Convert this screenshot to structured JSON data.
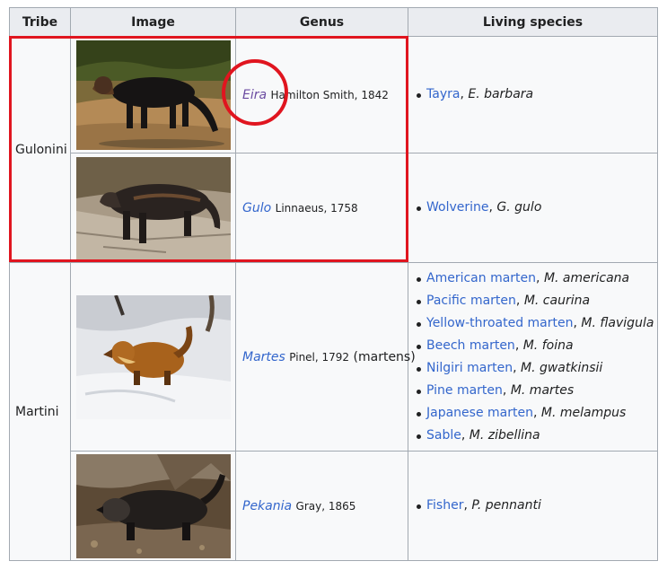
{
  "headers": [
    "Tribe",
    "Image",
    "Genus",
    "Living species"
  ],
  "tribes": {
    "gulonini": "Gulonini",
    "martini": "Martini"
  },
  "rows": {
    "eira": {
      "genus": "Eira",
      "authority": "Hamilton Smith, 1842",
      "species": [
        {
          "common": "Tayra",
          "sci": "E. barbara"
        }
      ]
    },
    "gulo": {
      "genus": "Gulo",
      "authority": "Linnaeus, 1758",
      "species": [
        {
          "common": "Wolverine",
          "sci": "G. gulo"
        }
      ]
    },
    "martes": {
      "genus": "Martes",
      "authority": "Pinel, 1792",
      "note": "(martens)",
      "species": [
        {
          "common": "American marten",
          "sci": "M. americana"
        },
        {
          "common": "Pacific marten",
          "sci": "M. caurina"
        },
        {
          "common": "Yellow-throated marten",
          "sci": "M. flavigula"
        },
        {
          "common": "Beech marten",
          "sci": "M. foina"
        },
        {
          "common": "Nilgiri marten",
          "sci": "M. gwatkinsii"
        },
        {
          "common": "Pine marten",
          "sci": "M. martes"
        },
        {
          "common": "Japanese marten",
          "sci": "M. melampus"
        },
        {
          "common": "Sable",
          "sci": "M. zibellina"
        }
      ]
    },
    "pekania": {
      "genus": "Pekania",
      "authority": "Gray, 1865",
      "species": [
        {
          "common": "Fisher",
          "sci": "P. pennanti"
        }
      ]
    }
  },
  "colors": {
    "link": "#3366cc",
    "visited_link": "#6b4ba1",
    "header_bg": "#eaecf0",
    "cell_bg": "#f8f9fa",
    "annotation": "#e0151f"
  }
}
